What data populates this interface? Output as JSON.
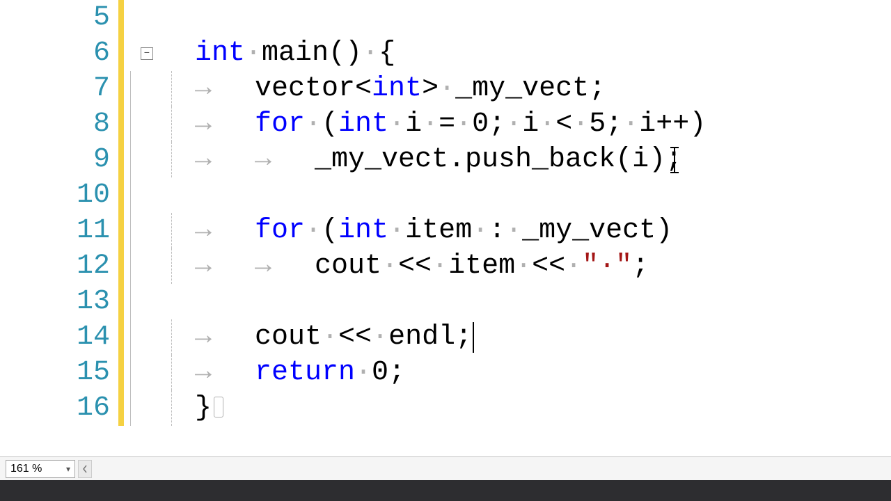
{
  "editor": {
    "zoom_label": "161 %",
    "cursor": {
      "line": 14,
      "col_after": "endl;"
    },
    "active_line": 14,
    "change_bar": {
      "start": 5,
      "end": 16,
      "color": "#f5d142"
    },
    "fold": {
      "line": 6,
      "state": "expanded"
    },
    "whitespace_visible": true,
    "lines": [
      {
        "num": 5,
        "tokens": []
      },
      {
        "num": 6,
        "tokens": [
          {
            "t": "kw",
            "v": "int"
          },
          {
            "t": "ws-dot",
            "v": "·"
          },
          {
            "t": "ident",
            "v": "main()"
          },
          {
            "t": "ws-dot",
            "v": "·"
          },
          {
            "t": "op",
            "v": "{"
          }
        ]
      },
      {
        "num": 7,
        "tokens": [
          {
            "t": "ws-arrow",
            "v": "→"
          },
          {
            "t": "ident",
            "v": "vector"
          },
          {
            "t": "op",
            "v": "<"
          },
          {
            "t": "kw",
            "v": "int"
          },
          {
            "t": "op",
            "v": ">"
          },
          {
            "t": "ws-dot",
            "v": "·"
          },
          {
            "t": "ident",
            "v": "_my_vect;"
          }
        ]
      },
      {
        "num": 8,
        "tokens": [
          {
            "t": "ws-arrow",
            "v": "→"
          },
          {
            "t": "kw",
            "v": "for"
          },
          {
            "t": "ws-dot",
            "v": "·"
          },
          {
            "t": "op",
            "v": "("
          },
          {
            "t": "kw",
            "v": "int"
          },
          {
            "t": "ws-dot",
            "v": "·"
          },
          {
            "t": "ident",
            "v": "i"
          },
          {
            "t": "ws-dot",
            "v": "·"
          },
          {
            "t": "op",
            "v": "="
          },
          {
            "t": "ws-dot",
            "v": "·"
          },
          {
            "t": "num",
            "v": "0"
          },
          {
            "t": "op",
            "v": ";"
          },
          {
            "t": "ws-dot",
            "v": "·"
          },
          {
            "t": "ident",
            "v": "i"
          },
          {
            "t": "ws-dot",
            "v": "·"
          },
          {
            "t": "op",
            "v": "<"
          },
          {
            "t": "ws-dot",
            "v": "·"
          },
          {
            "t": "num",
            "v": "5"
          },
          {
            "t": "op",
            "v": ";"
          },
          {
            "t": "ws-dot",
            "v": "·"
          },
          {
            "t": "ident",
            "v": "i++"
          },
          {
            "t": "op",
            "v": ")"
          }
        ]
      },
      {
        "num": 9,
        "tokens": [
          {
            "t": "ws-arrow",
            "v": "→"
          },
          {
            "t": "ws-arrow2",
            "v": "→"
          },
          {
            "t": "ident",
            "v": "_my_vect.push_back(i);"
          }
        ]
      },
      {
        "num": 10,
        "tokens": []
      },
      {
        "num": 11,
        "tokens": [
          {
            "t": "ws-arrow",
            "v": "→"
          },
          {
            "t": "kw",
            "v": "for"
          },
          {
            "t": "ws-dot",
            "v": "·"
          },
          {
            "t": "op",
            "v": "("
          },
          {
            "t": "kw",
            "v": "int"
          },
          {
            "t": "ws-dot",
            "v": "·"
          },
          {
            "t": "ident",
            "v": "item"
          },
          {
            "t": "ws-dot",
            "v": "·"
          },
          {
            "t": "op",
            "v": ":"
          },
          {
            "t": "ws-dot",
            "v": "·"
          },
          {
            "t": "ident",
            "v": "_my_vect"
          },
          {
            "t": "op",
            "v": ")"
          }
        ]
      },
      {
        "num": 12,
        "tokens": [
          {
            "t": "ws-arrow",
            "v": "→"
          },
          {
            "t": "ws-arrow2",
            "v": "→"
          },
          {
            "t": "ident",
            "v": "cout"
          },
          {
            "t": "ws-dot",
            "v": "·"
          },
          {
            "t": "op",
            "v": "<<"
          },
          {
            "t": "ws-dot",
            "v": "·"
          },
          {
            "t": "ident",
            "v": "item"
          },
          {
            "t": "ws-dot",
            "v": "·"
          },
          {
            "t": "op",
            "v": "<<"
          },
          {
            "t": "ws-dot",
            "v": "·"
          },
          {
            "t": "str",
            "v": "\"·\""
          },
          {
            "t": "op",
            "v": ";"
          }
        ]
      },
      {
        "num": 13,
        "tokens": []
      },
      {
        "num": 14,
        "tokens": [
          {
            "t": "ws-arrow",
            "v": "→"
          },
          {
            "t": "ident",
            "v": "cout"
          },
          {
            "t": "ws-dot",
            "v": "·"
          },
          {
            "t": "op",
            "v": "<<"
          },
          {
            "t": "ws-dot",
            "v": "·"
          },
          {
            "t": "ident",
            "v": "endl"
          },
          {
            "t": "op",
            "v": ";"
          }
        ]
      },
      {
        "num": 15,
        "tokens": [
          {
            "t": "ws-arrow",
            "v": "→"
          },
          {
            "t": "kw",
            "v": "return"
          },
          {
            "t": "ws-dot",
            "v": "·"
          },
          {
            "t": "num",
            "v": "0"
          },
          {
            "t": "op",
            "v": ";"
          }
        ]
      },
      {
        "num": 16,
        "tokens": [
          {
            "t": "op",
            "v": "}"
          }
        ],
        "eol_glyph": true
      }
    ]
  },
  "colors": {
    "keyword": "#0000ff",
    "string": "#a31515",
    "linenum": "#2b91af",
    "change_bar": "#f5d142",
    "whitespace": "#b0b0b0"
  }
}
